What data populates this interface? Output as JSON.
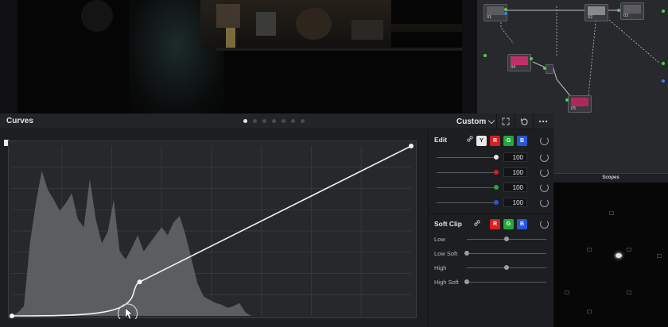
{
  "curves": {
    "title": "Curves",
    "page_dots": 7,
    "active_dot": 0,
    "mode": "Custom"
  },
  "edit": {
    "title": "Edit",
    "channels": [
      {
        "label": "Y",
        "color": "#e8e8e8",
        "text": "#222"
      },
      {
        "label": "R",
        "color": "#d42020",
        "text": "#fff"
      },
      {
        "label": "G",
        "color": "#22a83a",
        "text": "#fff"
      },
      {
        "label": "B",
        "color": "#2a55d8",
        "text": "#fff"
      }
    ],
    "sliders": [
      {
        "color": "#e6e6e6",
        "value": "100"
      },
      {
        "color": "#d42020",
        "value": "100"
      },
      {
        "color": "#22a83a",
        "value": "100"
      },
      {
        "color": "#2a55d8",
        "value": "100"
      }
    ]
  },
  "soft_clip": {
    "title": "Soft Clip",
    "channels": [
      {
        "label": "R",
        "color": "#d42020"
      },
      {
        "label": "G",
        "color": "#22a83a"
      },
      {
        "label": "B",
        "color": "#2a55d8"
      }
    ],
    "rows": [
      {
        "label": "Low",
        "level": 0.5
      },
      {
        "label": "Low Soft",
        "level": 0.0
      },
      {
        "label": "High",
        "level": 0.5
      },
      {
        "label": "High Soft",
        "level": 0.0
      }
    ]
  },
  "scopes": {
    "title": "Scopes"
  },
  "nodes": [
    {
      "label": "01"
    },
    {
      "label": "02"
    },
    {
      "label": "03"
    },
    {
      "label": "04"
    },
    {
      "label": "05"
    }
  ],
  "chart_data": {
    "type": "area",
    "title": "",
    "curve_points": [
      [
        0,
        0
      ],
      [
        0.32,
        0.2
      ],
      [
        1,
        1
      ]
    ],
    "histogram": [
      0,
      0.02,
      0.06,
      0.45,
      0.7,
      0.9,
      0.78,
      0.72,
      0.65,
      0.7,
      0.76,
      0.6,
      0.55,
      0.85,
      0.6,
      0.45,
      0.52,
      0.72,
      0.4,
      0.35,
      0.42,
      0.5,
      0.4,
      0.45,
      0.5,
      0.55,
      0.5,
      0.58,
      0.62,
      0.5,
      0.35,
      0.2,
      0.12,
      0.1,
      0.08,
      0.07,
      0.05,
      0.06,
      0.08,
      0.02,
      0.0
    ]
  }
}
